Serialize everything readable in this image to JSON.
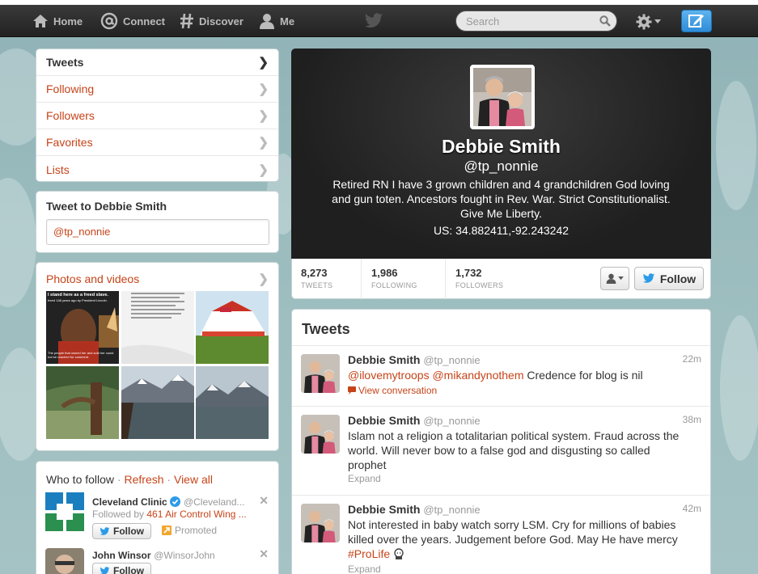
{
  "topnav": {
    "home": "Home",
    "connect": "Connect",
    "discover": "Discover",
    "me": "Me",
    "search_placeholder": "Search"
  },
  "sidebar": {
    "items": [
      {
        "label": "Tweets",
        "active": true
      },
      {
        "label": "Following"
      },
      {
        "label": "Followers"
      },
      {
        "label": "Favorites"
      },
      {
        "label": "Lists"
      }
    ]
  },
  "tweet_to": {
    "title": "Tweet to Debbie Smith",
    "value": "@tp_nonnie"
  },
  "photos": {
    "title": "Photos and videos",
    "thumb1_caption_top": "I stand here as a freed slave.",
    "thumb1_caption_mid": "freed 148 years ago by President Lincoln.",
    "thumb1_caption_bottom": "The people that owned her and sold her could not be reached for comment."
  },
  "who_to_follow": {
    "title": "Who to follow",
    "refresh": "Refresh",
    "view_all": "View all",
    "suggestions": [
      {
        "name": "Cleveland Clinic",
        "handle": "@Cleveland...",
        "followed_by_prefix": "Followed by",
        "followed_by": "461 Air Control Wing ...",
        "follow_label": "Follow",
        "promoted": "Promoted"
      },
      {
        "name": "John Winsor",
        "handle": "@WinsorJohn",
        "follow_label": "Follow"
      }
    ]
  },
  "profile": {
    "name": "Debbie Smith",
    "handle": "@tp_nonnie",
    "bio": "Retired RN I have 3 grown children and 4 grandchildren God loving and gun toten. Ancestors fought in Rev. War. Strict Constitutionalist. Give Me Liberty.",
    "location": "US: 34.882411,-92.243242",
    "stats": [
      {
        "value": "8,273",
        "label": "TWEETS"
      },
      {
        "value": "1,986",
        "label": "FOLLOWING"
      },
      {
        "value": "1,732",
        "label": "FOLLOWERS"
      }
    ],
    "follow_label": "Follow"
  },
  "tweets": {
    "title": "Tweets",
    "items": [
      {
        "name": "Debbie Smith",
        "handle": "@tp_nonnie",
        "time": "22m",
        "mention1": "@ilovemytroops",
        "mention2": "@mikandynothem",
        "text": "Credence for blog is nil",
        "action": "View conversation"
      },
      {
        "name": "Debbie Smith",
        "handle": "@tp_nonnie",
        "time": "38m",
        "text": "Islam not a religion a totalitarian political system. Fraud across the world. Will never bow to a false god and disgusting so called prophet",
        "action": "Expand"
      },
      {
        "name": "Debbie Smith",
        "handle": "@tp_nonnie",
        "time": "42m",
        "text": "Not interested in baby watch sorry LSM. Cry for millions of babies killed over the years. Judgement before God. May He have mercy",
        "hashtag": "#ProLife",
        "action": "Expand"
      }
    ]
  },
  "colors": {
    "link": "#c64419",
    "topbar": "#2a2a2a",
    "background": "#9bbcbe",
    "verified": "#2b9be8"
  }
}
